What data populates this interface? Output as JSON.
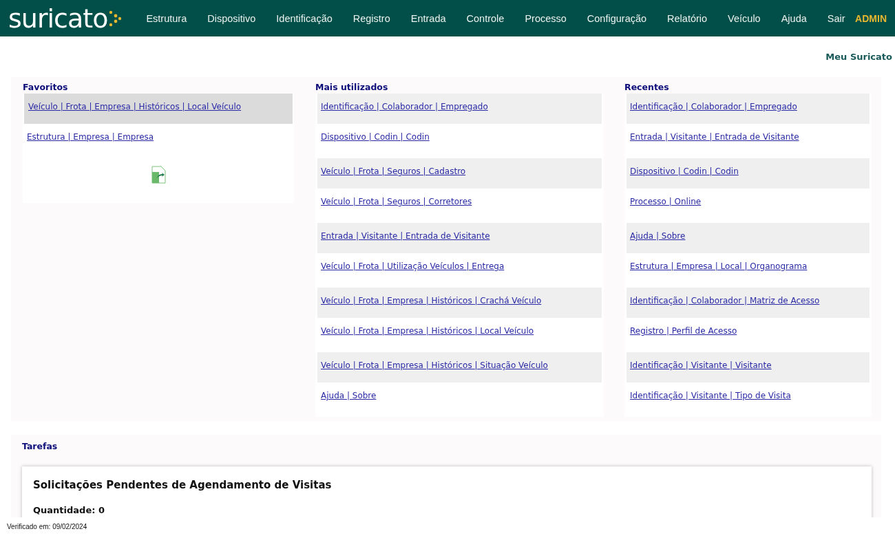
{
  "brand": {
    "logo": "suricato"
  },
  "nav": {
    "items": [
      "Estrutura",
      "Dispositivo",
      "Identificação",
      "Registro",
      "Entrada",
      "Controle",
      "Processo",
      "Configuração",
      "Relatório",
      "Veículo",
      "Ajuda",
      "Sair"
    ],
    "user": "ADMIN"
  },
  "page_title": "Meu Suricato",
  "favorites": {
    "title": "Favoritos",
    "items": [
      {
        "label": "Veículo | Frota | Empresa | Históricos | Local Veículo",
        "selected": true
      },
      {
        "label": "Estrutura | Empresa | Empresa",
        "selected": false
      }
    ]
  },
  "most_used": {
    "title": "Mais utilizados",
    "items": [
      "Identificação | Colaborador | Empregado",
      "Dispositivo | Codin | Codin",
      "Veículo | Frota | Seguros | Cadastro",
      "Veículo | Frota | Seguros | Corretores",
      "Entrada | Visitante | Entrada de Visitante",
      "Veículo | Frota | Utilização Veículos | Entrega",
      "Veículo | Frota | Empresa | Históricos | Crachá Veículo",
      "Veículo | Frota | Empresa | Históricos | Local Veículo",
      "Veículo | Frota | Empresa | Históricos | Situação Veículo",
      "Ajuda | Sobre"
    ]
  },
  "recent": {
    "title": "Recentes",
    "items": [
      "Identificação | Colaborador | Empregado",
      "Entrada | Visitante | Entrada de Visitante",
      "Dispositivo | Codin | Codin",
      "Processo | Online",
      "Ajuda | Sobre",
      "Estrutura | Empresa | Local | Organograma",
      "Identificação | Colaborador | Matriz de Acesso",
      "Registro | Perfil de Acesso",
      "Identificação | Visitante | Visitante",
      "Identificação | Visitante | Tipo de Visita"
    ]
  },
  "tasks": {
    "title": "Tarefas",
    "card": {
      "title": "Solicitações Pendentes de Agendamento de Visitas",
      "count": "Quantidade: 0"
    }
  },
  "footer": "Verificado em: 09/02/2024"
}
